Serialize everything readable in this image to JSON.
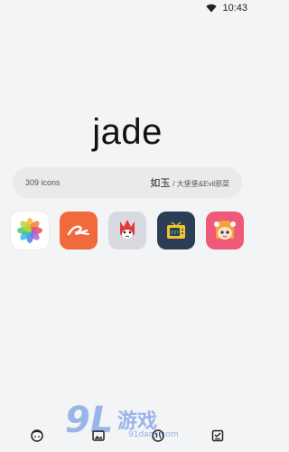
{
  "status_bar": {
    "time": "10:43",
    "icons": [
      "wifi-icon"
    ]
  },
  "title": "jade",
  "info": {
    "count": "309 icons",
    "name": "如玉",
    "authors": "/ 大堡堡&Evil邪菜"
  },
  "app_icons": [
    {
      "name": "photos-icon",
      "color": "#ffffff"
    },
    {
      "name": "alibaba-icon",
      "color": "#f06a3c"
    },
    {
      "name": "fox-icon",
      "color": "#d9dadf"
    },
    {
      "name": "iqiyi-tv-icon",
      "color": "#2c3e55"
    },
    {
      "name": "anime-girl-icon",
      "color": "#ef5a78"
    }
  ],
  "bottom_nav": [
    "face-icon",
    "image-icon",
    "globe-icon",
    "checklist-icon"
  ],
  "watermark": {
    "logo": "9L",
    "text": "游戏",
    "url": "91danji.com"
  }
}
